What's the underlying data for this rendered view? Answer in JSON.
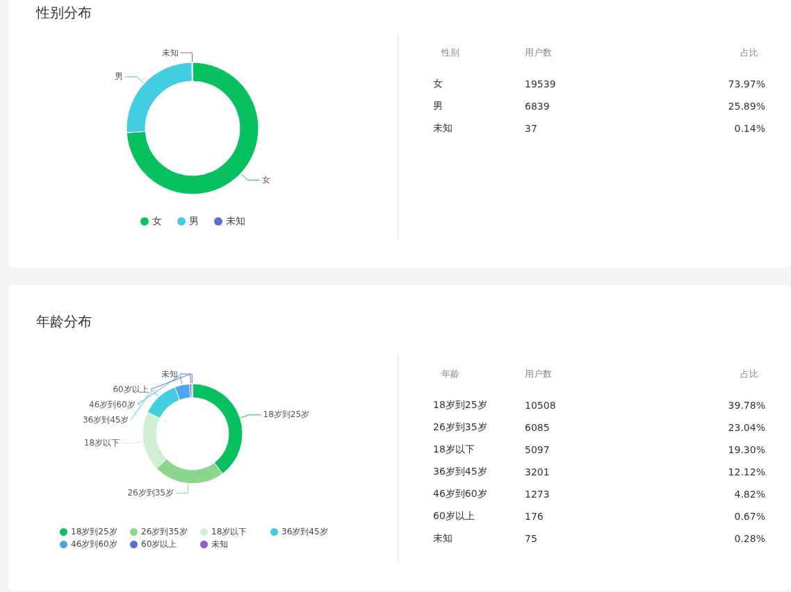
{
  "sections": [
    {
      "title": "性别分布",
      "chart": {
        "chart_data": {
          "type": "donut",
          "categories": [
            "女",
            "男",
            "未知"
          ],
          "values": [
            73.97,
            25.89,
            0.14
          ]
        }
      },
      "legend": [
        {
          "label": "女",
          "color": "#07c160"
        },
        {
          "label": "男",
          "color": "#42cde0"
        },
        {
          "label": "未知",
          "color": "#5b6fd0"
        }
      ],
      "table": {
        "columns": [
          "性别",
          "用户数",
          "占比"
        ],
        "rows": [
          [
            "女",
            "19539",
            "73.97%"
          ],
          [
            "男",
            "6839",
            "25.89%"
          ],
          [
            "未知",
            "37",
            "0.14%"
          ]
        ]
      }
    },
    {
      "title": "年龄分布",
      "chart": {
        "chart_data": {
          "type": "donut",
          "categories": [
            "18岁到25岁",
            "26岁到35岁",
            "18岁以下",
            "36岁到45岁",
            "46岁到60岁",
            "60岁以上",
            "未知"
          ],
          "values": [
            39.78,
            23.04,
            19.3,
            12.12,
            4.82,
            0.67,
            0.28
          ]
        }
      },
      "legend": [
        {
          "label": "18岁到25岁",
          "color": "#07c160"
        },
        {
          "label": "26岁到35岁",
          "color": "#8dd68e"
        },
        {
          "label": "18岁以下",
          "color": "#d1f0d3"
        },
        {
          "label": "36岁到45岁",
          "color": "#42cde0"
        },
        {
          "label": "46岁到60岁",
          "color": "#4ea6ec"
        },
        {
          "label": "60岁以上",
          "color": "#5b6fd0"
        },
        {
          "label": "未知",
          "color": "#8c5ed4"
        }
      ],
      "table": {
        "columns": [
          "年龄",
          "用户数",
          "占比"
        ],
        "rows": [
          [
            "18岁到25岁",
            "10508",
            "39.78%"
          ],
          [
            "26岁到35岁",
            "6085",
            "23.04%"
          ],
          [
            "18岁以下",
            "5097",
            "19.30%"
          ],
          [
            "36岁到45岁",
            "3201",
            "12.12%"
          ],
          [
            "46岁到60岁",
            "1273",
            "4.82%"
          ],
          [
            "60岁以上",
            "176",
            "0.67%"
          ],
          [
            "未知",
            "75",
            "0.28%"
          ]
        ]
      }
    }
  ]
}
